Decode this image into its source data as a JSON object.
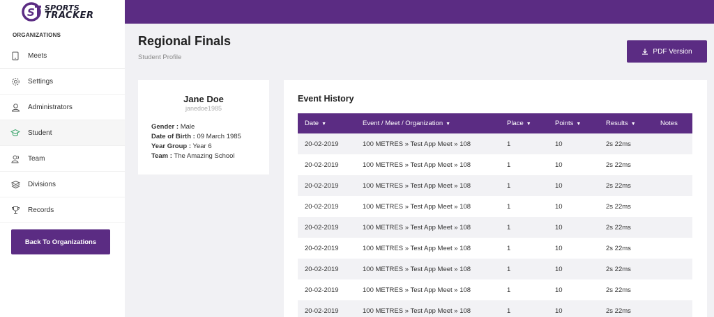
{
  "brand": {
    "line1": "SPORTS",
    "line2": "TRACKER",
    "mark": "S",
    "accent": "#5b2c83"
  },
  "sidebar": {
    "heading": "ORGANIZATIONS",
    "items": [
      {
        "label": "Meets",
        "icon": "tablet-icon"
      },
      {
        "label": "Settings",
        "icon": "gear-icon"
      },
      {
        "label": "Administrators",
        "icon": "user-icon"
      },
      {
        "label": "Student",
        "icon": "graduation-cap-icon",
        "active": true
      },
      {
        "label": "Team",
        "icon": "team-icon"
      },
      {
        "label": "Divisions",
        "icon": "layers-icon"
      },
      {
        "label": "Records",
        "icon": "trophy-icon"
      }
    ],
    "back_button": "Back To Organizations"
  },
  "page": {
    "title": "Regional Finals",
    "subtitle": "Student Profile",
    "pdf_button": "PDF Version"
  },
  "profile": {
    "name": "Jane Doe",
    "username": "janedoe1985",
    "gender_label": "Gender :",
    "gender": "Male",
    "dob_label": "Date of Birth :",
    "dob": "09 March 1985",
    "year_label": "Year Group :",
    "year": "Year 6",
    "team_label": "Team :",
    "team": "The Amazing School"
  },
  "history": {
    "title": "Event History",
    "columns": [
      "Date",
      "Event / Meet / Organization",
      "Place",
      "Points",
      "Results",
      "Notes"
    ],
    "rows": [
      [
        "20-02-2019",
        "100 METRES » Test App Meet » 108",
        "1",
        "10",
        "2s 22ms",
        ""
      ],
      [
        "20-02-2019",
        "100 METRES » Test App Meet » 108",
        "1",
        "10",
        "2s 22ms",
        ""
      ],
      [
        "20-02-2019",
        "100 METRES » Test App Meet » 108",
        "1",
        "10",
        "2s 22ms",
        ""
      ],
      [
        "20-02-2019",
        "100 METRES » Test App Meet » 108",
        "1",
        "10",
        "2s 22ms",
        ""
      ],
      [
        "20-02-2019",
        "100 METRES » Test App Meet » 108",
        "1",
        "10",
        "2s 22ms",
        ""
      ],
      [
        "20-02-2019",
        "100 METRES » Test App Meet » 108",
        "1",
        "10",
        "2s 22ms",
        ""
      ],
      [
        "20-02-2019",
        "100 METRES » Test App Meet » 108",
        "1",
        "10",
        "2s 22ms",
        ""
      ],
      [
        "20-02-2019",
        "100 METRES » Test App Meet » 108",
        "1",
        "10",
        "2s 22ms",
        ""
      ],
      [
        "20-02-2019",
        "100 METRES » Test App Meet » 108",
        "1",
        "10",
        "2s 22ms",
        ""
      ]
    ]
  }
}
